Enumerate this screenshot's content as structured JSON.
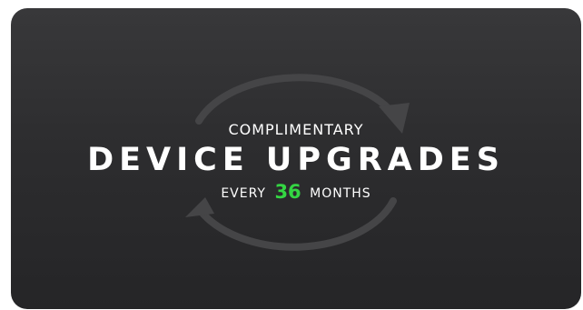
{
  "card": {
    "eyebrow": "COMPLIMENTARY",
    "headline": "DEVICE UPGRADES",
    "subline_prefix": "EVERY",
    "subline_number": "36",
    "subline_suffix": "MONTHS"
  },
  "colors": {
    "background": "#2f2f31",
    "text": "#ffffff",
    "accent": "#34d643",
    "cycle_icon": "#4a4a4c"
  },
  "icon": "cycle-arrows-icon"
}
